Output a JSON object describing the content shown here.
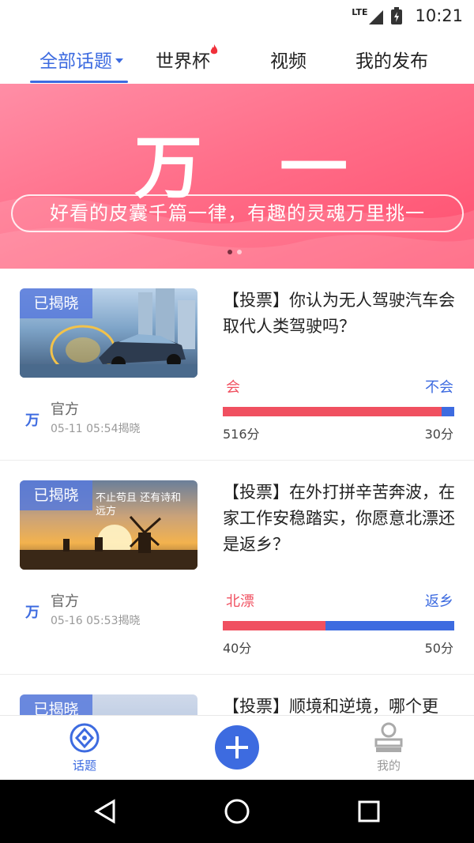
{
  "status_bar": {
    "network": "LTE",
    "time": "10:21"
  },
  "tabs": [
    {
      "label": "全部话题",
      "active": true
    },
    {
      "label": "世界杯",
      "hot": true
    },
    {
      "label": "视频"
    },
    {
      "label": "我的发布"
    }
  ],
  "banner": {
    "title": "万 一",
    "slogan": "好看的皮囊千篇一律，有趣的灵魂万里挑一",
    "page_count": 2,
    "active_index": 0
  },
  "cards": [
    {
      "badge": "已揭晓",
      "question": "【投票】你认为无人驾驶汽车会取代人类驾驶吗？",
      "author": "官方",
      "author_logo": "万",
      "date": "05-11 05:54揭晓",
      "left_option": "会",
      "right_option": "不会",
      "left_score": "516分",
      "right_score": "30分",
      "left_fraction": 0.945
    },
    {
      "badge": "已揭晓",
      "thumb_caption": "不止苟且 还有诗和远方",
      "question": "【投票】在外打拼辛苦奔波，在家工作安稳踏实，你愿意北漂还是返乡？",
      "author": "官方",
      "author_logo": "万",
      "date": "05-16 05:53揭晓",
      "left_option": "北漂",
      "right_option": "返乡",
      "left_score": "40分",
      "right_score": "50分",
      "left_fraction": 0.444
    },
    {
      "badge": "已揭晓",
      "question": "【投票】顺境和逆境，哪个更"
    }
  ],
  "bottom_nav": [
    {
      "label": "话题",
      "icon": "topic-icon",
      "active": true
    },
    {
      "label": "",
      "icon": "plus-icon"
    },
    {
      "label": "我的",
      "icon": "user-icon"
    }
  ],
  "colors": {
    "accent": "#3d6be0",
    "vote_red": "#f05060",
    "banner_pink": "#ff6f8a"
  }
}
